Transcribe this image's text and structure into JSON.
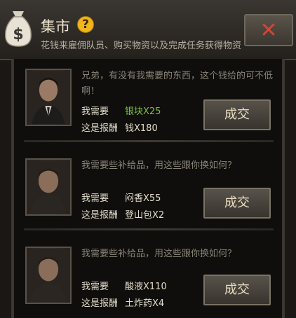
{
  "header": {
    "title": "集市",
    "help_glyph": "?",
    "subtitle": "花钱来雇佣队员、购买物资以及完成任务获得物资",
    "close_glyph": "✕"
  },
  "trades": [
    {
      "dialog": "兄弟，有没有我需要的东西，这个钱给的可不低啊！",
      "need_label": "我需要",
      "need_value": "银块X25",
      "need_color": "#7cc043",
      "reward_label": "这是报酬",
      "reward_value": "钱X180",
      "button": "成交"
    },
    {
      "dialog": "我需要些补给品，用这些跟你换如何？",
      "need_label": "我需要",
      "need_value": "闷香X55",
      "need_color": "#e4dccb",
      "reward_label": "这是报酬",
      "reward_value": "登山包X2",
      "button": "成交"
    },
    {
      "dialog": "我需要些补给品，用这些跟你换如何？",
      "need_label": "我需要",
      "need_value": "酸液X110",
      "need_color": "#e4dccb",
      "reward_label": "这是报酬",
      "reward_value": "土炸药X4",
      "button": "成交"
    }
  ],
  "colors": {
    "accent_green": "#7cc043",
    "close_red": "#c84a3a",
    "help_yellow": "#f0b51a"
  }
}
